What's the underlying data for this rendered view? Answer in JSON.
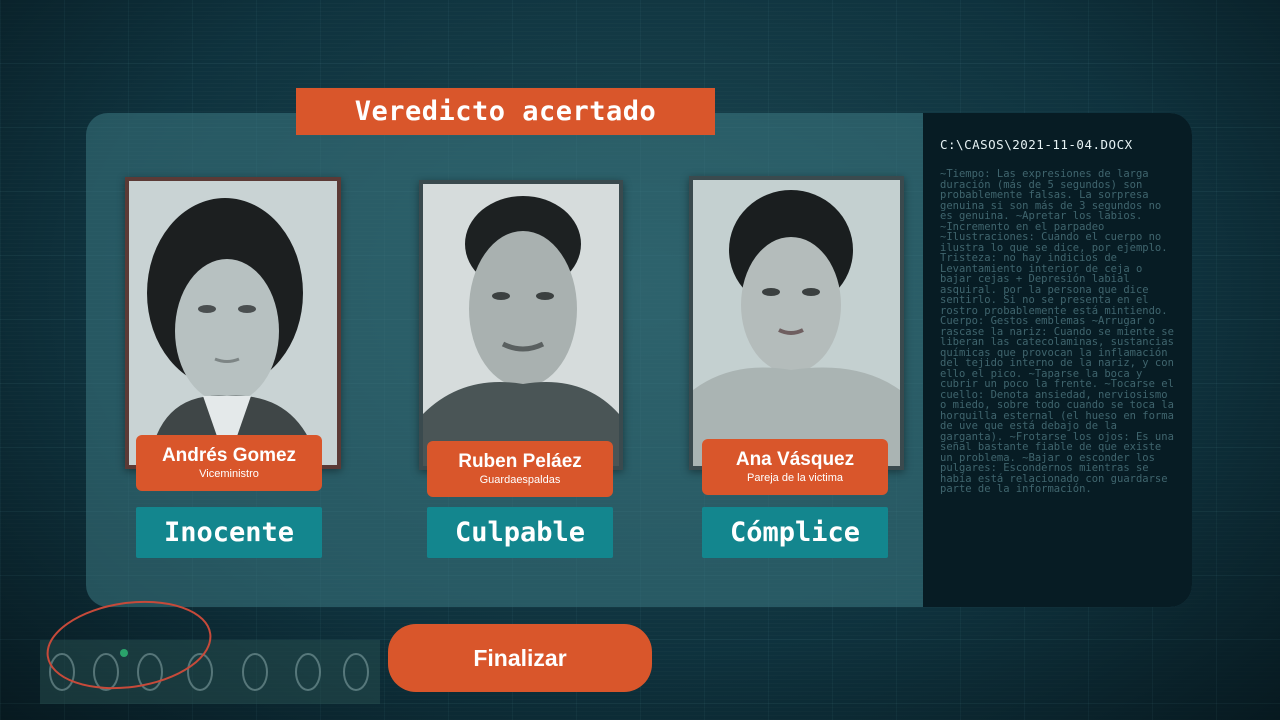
{
  "banner": {
    "title": "Veredicto acertado"
  },
  "document": {
    "path": "C:\\CASOS\\2021-11-04.DOCX",
    "body": "~Tiempo: Las expresiones de larga duración (más de 5 segundos) son probablemente falsas. La sorpresa genuina si son más de 3 segundos no es genuina. ~Apretar los labios. ~Incremento en el parpadeo ~Ilustraciones: Cuando el cuerpo no ilustra lo que se dice, por ejemplo. Tristeza: no hay indicios de Levantamiento interior de ceja o bajar cejas + Depresión labial asquiral. por la persona que dice sentirlo. Si no se presenta en el rostro probablemente está mintiendo. Cuerpo: Gestos emblemas ~Arrugar o rascase la nariz: Cuando se miente se liberan las catecolaminas, sustancias químicas que provocan la inflamación del tejido interno de la nariz, y con ello el pico. ~Taparse la boca y cubrir un poco la frente. ~Tocarse el cuello: Denota ansiedad, nerviosismo o miedo, sobre todo cuando se toca la horquilla esternal (el hueso en forma de uve que está debajo de la garganta). ~Frotarse los ojos: Es una señal bastante fiable de que existe un problema. ~Bajar o esconder los pulgares: Escondernos mientras se había está relacionado con guardarse parte de la información."
  },
  "suspects": [
    {
      "name": "Andrés Gomez",
      "role": "Viceministro",
      "verdict": "Inocente"
    },
    {
      "name": "Ruben Peláez",
      "role": "Guardaespaldas",
      "verdict": "Culpable"
    },
    {
      "name": "Ana Vásquez",
      "role": "Pareja de la victima",
      "verdict": "Cómplice"
    }
  ],
  "actions": {
    "finalize": "Finalizar"
  },
  "colors": {
    "accent": "#d9562b",
    "teal": "#13868e",
    "panel": "#3c7882",
    "doc_bg": "#071c24"
  }
}
